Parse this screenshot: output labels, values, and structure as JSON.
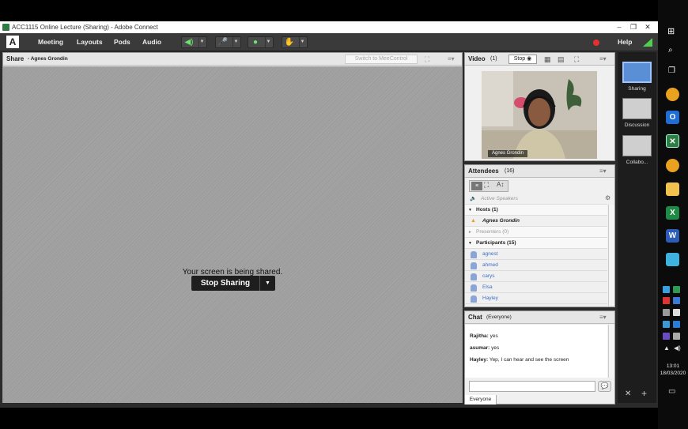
{
  "window": {
    "title": "ACC1115 Online Lecture (Sharing) - Adobe Connect",
    "controls": [
      "–",
      "❐",
      "✕"
    ]
  },
  "menubar": {
    "items": [
      "Meeting",
      "Layouts",
      "Pods",
      "Audio"
    ],
    "help": "Help"
  },
  "share_pod": {
    "title": "Share",
    "presenter": "- Agnes Grondin",
    "switch_button": "Switch to MeeControl",
    "message": "Your screen is being shared.",
    "stop_button": "Stop Sharing"
  },
  "video_pod": {
    "title": "Video",
    "count": "(1)",
    "stop_button": "Stop",
    "caption": "Agnes Grondin"
  },
  "attendees_pod": {
    "title": "Attendees",
    "count": "(16)",
    "active_speakers": "Active Speakers",
    "hosts_label": "Hosts (1)",
    "host_name": "Agnes Grondin",
    "presenters_label": "Presenters (0)",
    "participants_label": "Participants (15)",
    "participants": [
      "agnest",
      "ahmed",
      "carys",
      "Elsa",
      "Hayley"
    ]
  },
  "chat_pod": {
    "title": "Chat",
    "scope": "(Everyone)",
    "messages": [
      {
        "sender": "Rajitha:",
        "text": "yes"
      },
      {
        "sender": "asumar:",
        "text": "yes"
      },
      {
        "sender": "Hayley:",
        "text": "Yep, I can hear and see the screen"
      }
    ],
    "tab": "Everyone"
  },
  "layouts_panel": {
    "items": [
      "Sharing",
      "Discussion",
      "Collabo..."
    ]
  },
  "taskbar": {
    "time": "13:01",
    "date": "18/03/2020"
  },
  "colors": {
    "accent_green": "#4fd04f",
    "record_red": "#e53030",
    "link_blue": "#3a6fc2"
  }
}
